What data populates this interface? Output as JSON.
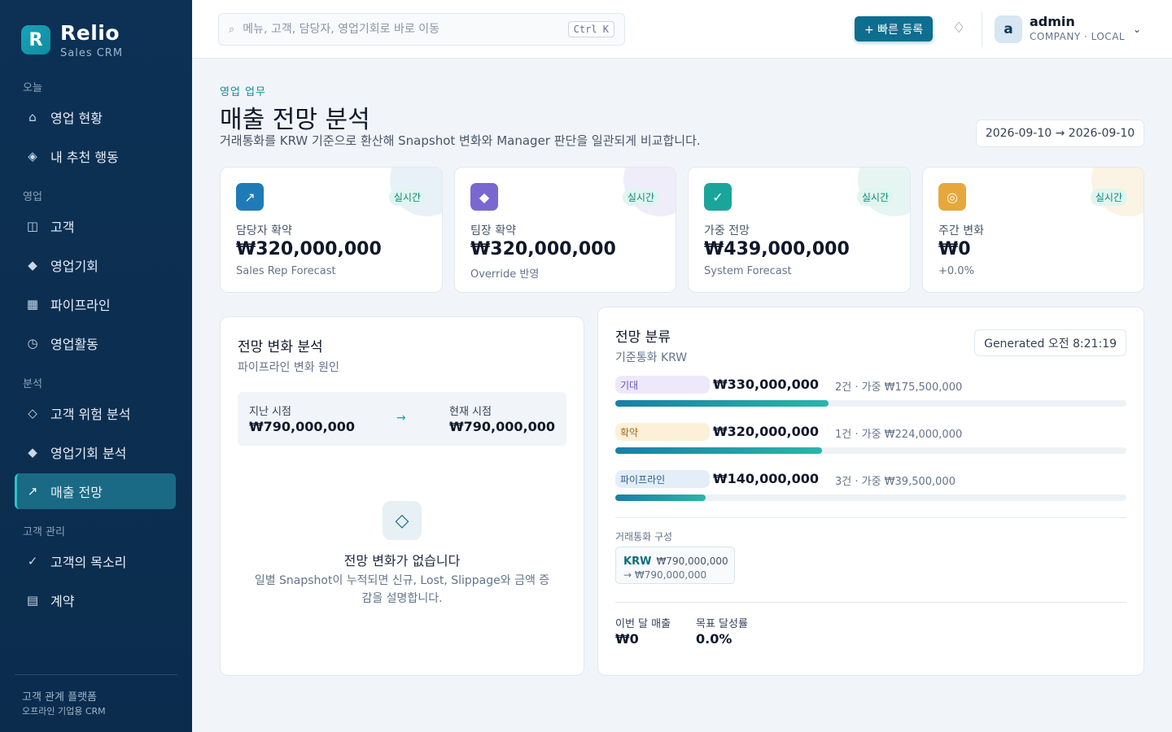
{
  "brand": {
    "logo_letter": "R",
    "name": "Relio",
    "subtitle": "Sales CRM"
  },
  "sidebar": {
    "sections": [
      {
        "label": "오늘"
      },
      {
        "label": "영업"
      },
      {
        "label": "분석"
      },
      {
        "label": "고객 관리"
      }
    ],
    "items": [
      {
        "label": "영업 현황",
        "icon": "home-icon",
        "glyph": "⌂"
      },
      {
        "label": "내 추천 행동",
        "icon": "diamond-icon",
        "glyph": "◈"
      },
      {
        "label": "고객",
        "icon": "building-icon",
        "glyph": "◫"
      },
      {
        "label": "영업기회",
        "icon": "diamond-filled-icon",
        "glyph": "◆"
      },
      {
        "label": "파이프라인",
        "icon": "grid-icon",
        "glyph": "▦"
      },
      {
        "label": "영업활동",
        "icon": "clock-icon",
        "glyph": "◷"
      },
      {
        "label": "고객 위험 분석",
        "icon": "diamond-outline-icon",
        "glyph": "◇"
      },
      {
        "label": "영업기회 분석",
        "icon": "diamond-filled-icon",
        "glyph": "◆"
      },
      {
        "label": "매출 전망",
        "icon": "trend-up-icon",
        "glyph": "↗",
        "active": true
      },
      {
        "label": "고객의 목소리",
        "icon": "check-icon",
        "glyph": "✓"
      },
      {
        "label": "계약",
        "icon": "document-icon",
        "glyph": "▤"
      }
    ],
    "footer": {
      "line1": "고객 관계 플랫폼",
      "line2": "오프라인 기업용 CRM"
    }
  },
  "topbar": {
    "search_placeholder": "메뉴, 고객, 담당자, 영업기회로 바로 이동",
    "search_shortcut": "Ctrl K",
    "quick_add_label": "+ 빠른 등록",
    "user": {
      "initial": "a",
      "name": "admin",
      "role": "COMPANY · LOCAL"
    }
  },
  "header": {
    "eyebrow": "영업 업무",
    "title": "매출 전망 분석",
    "description": "거래통화를 KRW 기준으로 환산해 Snapshot 변화와 Manager 판단을 일관되게 비교합니다.",
    "date_range": "2026-09-10 → 2026-09-10"
  },
  "kpis": [
    {
      "label": "담당자 확약",
      "value": "₩320,000,000",
      "sub": "Sales Rep Forecast",
      "badge": "실시간",
      "icon": "trend-up-icon",
      "glyph": "↗",
      "color": "#1f7bb8",
      "blob": "#e9f1f8"
    },
    {
      "label": "팀장 확약",
      "value": "₩320,000,000",
      "sub": "Override 반영",
      "badge": "실시간",
      "icon": "diamond-icon",
      "glyph": "◆",
      "color": "#7a67d1",
      "blob": "#efedf9"
    },
    {
      "label": "가중 전망",
      "value": "₩439,000,000",
      "sub": "System Forecast",
      "badge": "실시간",
      "icon": "check-icon",
      "glyph": "✓",
      "color": "#1aa59a",
      "blob": "#e6f5f2"
    },
    {
      "label": "주간 변화",
      "value": "₩0",
      "sub": "+0.0%",
      "badge": "실시간",
      "icon": "target-icon",
      "glyph": "◎",
      "color": "#e6a83a",
      "blob": "#fbf3e4"
    }
  ],
  "change_panel": {
    "title": "전망 변화 분석",
    "subtitle": "파이프라인 변화 원인",
    "previous_label": "지난 시점",
    "previous_value": "₩790,000,000",
    "current_label": "현재 시점",
    "current_value": "₩790,000,000",
    "arrow": "→",
    "empty_icon": "◇",
    "empty_title": "전망 변화가 없습니다",
    "empty_desc": "일별 Snapshot이 누적되면 신규, Lost, Slippage와 금액 증감을 설명합니다."
  },
  "category_panel": {
    "title": "전망 분류",
    "subtitle": "기준통화 KRW",
    "generated": "Generated 오전 8:21:19",
    "categories": [
      {
        "tag": "기대",
        "amount": "₩330,000,000",
        "meta": "2건 · 가중 ₩175,500,000",
        "share": 0.417,
        "tag_bg": "#ede9fb",
        "tag_color": "#6b52b8"
      },
      {
        "tag": "확약",
        "amount": "₩320,000,000",
        "meta": "1건 · 가중 ₩224,000,000",
        "share": 0.405,
        "tag_bg": "#fdf0d8",
        "tag_color": "#a86a12"
      },
      {
        "tag": "파이프라인",
        "amount": "₩140,000,000",
        "meta": "3건 · 가중 ₩39,500,000",
        "share": 0.177,
        "tag_bg": "#e3eef8",
        "tag_color": "#2a5f8e"
      }
    ],
    "currency_section_label": "거래통화 구성",
    "currency": {
      "code": "KRW",
      "amount": "₩790,000,000",
      "converted": "→ ₩790,000,000"
    },
    "stats": [
      {
        "label": "이번 달 매출",
        "value": "₩0"
      },
      {
        "label": "목표 달성률",
        "value": "0.0%"
      }
    ]
  }
}
